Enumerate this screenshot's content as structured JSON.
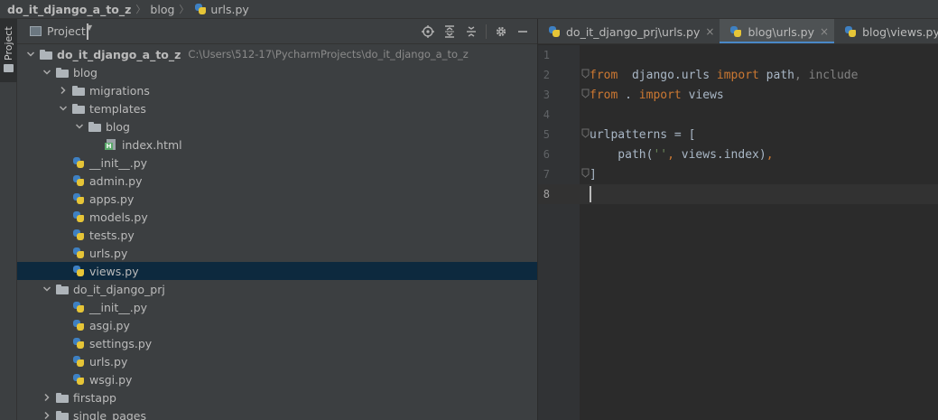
{
  "breadcrumb": [
    "do_it_django_a_to_z",
    "blog",
    "urls.py"
  ],
  "toolstrip": {
    "project_tab": "Project"
  },
  "project_panel": {
    "title": "Project",
    "tools": [
      "locate-icon",
      "expand-all-icon",
      "collapse-all-icon",
      "gear-icon",
      "hide-icon"
    ]
  },
  "tree": [
    {
      "depth": 0,
      "arrow": "down",
      "icon": "folder",
      "label": "do_it_django_a_to_z",
      "bold": true,
      "path": "C:\\Users\\512-17\\PycharmProjects\\do_it_django_a_to_z"
    },
    {
      "depth": 1,
      "arrow": "down",
      "icon": "folder",
      "label": "blog"
    },
    {
      "depth": 2,
      "arrow": "right",
      "icon": "folder",
      "label": "migrations"
    },
    {
      "depth": 2,
      "arrow": "down",
      "icon": "folder",
      "label": "templates"
    },
    {
      "depth": 3,
      "arrow": "down",
      "icon": "folder",
      "label": "blog"
    },
    {
      "depth": 4,
      "arrow": "none",
      "icon": "html",
      "label": "index.html"
    },
    {
      "depth": 2,
      "arrow": "none",
      "icon": "py",
      "label": "__init__.py"
    },
    {
      "depth": 2,
      "arrow": "none",
      "icon": "py",
      "label": "admin.py"
    },
    {
      "depth": 2,
      "arrow": "none",
      "icon": "py",
      "label": "apps.py"
    },
    {
      "depth": 2,
      "arrow": "none",
      "icon": "py",
      "label": "models.py"
    },
    {
      "depth": 2,
      "arrow": "none",
      "icon": "py",
      "label": "tests.py"
    },
    {
      "depth": 2,
      "arrow": "none",
      "icon": "py",
      "label": "urls.py"
    },
    {
      "depth": 2,
      "arrow": "none",
      "icon": "py",
      "label": "views.py",
      "selected": true
    },
    {
      "depth": 1,
      "arrow": "down",
      "icon": "folder",
      "label": "do_it_django_prj"
    },
    {
      "depth": 2,
      "arrow": "none",
      "icon": "py",
      "label": "__init__.py"
    },
    {
      "depth": 2,
      "arrow": "none",
      "icon": "py",
      "label": "asgi.py"
    },
    {
      "depth": 2,
      "arrow": "none",
      "icon": "py",
      "label": "settings.py"
    },
    {
      "depth": 2,
      "arrow": "none",
      "icon": "py",
      "label": "urls.py"
    },
    {
      "depth": 2,
      "arrow": "none",
      "icon": "py",
      "label": "wsgi.py"
    },
    {
      "depth": 1,
      "arrow": "right",
      "icon": "folder",
      "label": "firstapp"
    },
    {
      "depth": 1,
      "arrow": "right",
      "icon": "folder",
      "label": "single_pages"
    }
  ],
  "tabs": [
    {
      "label": "do_it_django_prj\\urls.py",
      "active": false,
      "closable": true
    },
    {
      "label": "blog\\urls.py",
      "active": true,
      "closable": true
    },
    {
      "label": "blog\\views.py",
      "active": false,
      "closable": true
    }
  ],
  "code": [
    {
      "n": "1",
      "tokens": []
    },
    {
      "n": "2",
      "fold": true,
      "tokens": [
        [
          "kw",
          "from"
        ],
        [
          "",
          "  django.urls "
        ],
        [
          "kw",
          "import"
        ],
        [
          "",
          " path"
        ],
        [
          "dim",
          ","
        ],
        [
          "dim",
          " include"
        ]
      ]
    },
    {
      "n": "3",
      "fold": true,
      "tokens": [
        [
          "kw",
          "from"
        ],
        [
          "",
          " . "
        ],
        [
          "kw",
          "import"
        ],
        [
          "",
          " views"
        ]
      ]
    },
    {
      "n": "4",
      "tokens": []
    },
    {
      "n": "5",
      "fold": true,
      "tokens": [
        [
          "",
          "urlpatterns = ["
        ]
      ]
    },
    {
      "n": "6",
      "tokens": [
        [
          "",
          "    path("
        ],
        [
          "str",
          "''"
        ],
        [
          "kw",
          ","
        ],
        [
          "",
          " views.index)"
        ],
        [
          "kw",
          ","
        ]
      ]
    },
    {
      "n": "7",
      "fold": true,
      "tokens": [
        [
          "",
          "]"
        ]
      ]
    },
    {
      "n": "8",
      "current": true,
      "caret": true,
      "tokens": []
    }
  ],
  "colors": {
    "selection": "#0d293e",
    "active_tab_underline": "#4a88c7",
    "keyword": "#cc7832",
    "string": "#6a8759"
  }
}
